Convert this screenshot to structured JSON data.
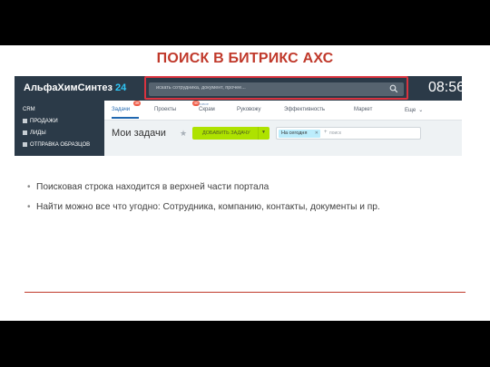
{
  "slide": {
    "title": "ПОИСК В БИТРИКС АХС",
    "bullets": [
      "Поисковая строка находится в верхней части портала",
      "Найти можно все что угодно: Сотрудника, компанию, контакты, документы и пр."
    ]
  },
  "portal": {
    "logo": "АльфаХимСинтез",
    "logo_number": "24",
    "search": {
      "placeholder": "искать сотрудника, документ, прочее..."
    },
    "clock": "08:56",
    "sidebar": {
      "items": [
        {
          "label": "CRM",
          "icon": "none"
        },
        {
          "label": "ПРОДАЖИ",
          "icon": "square-icon"
        },
        {
          "label": "ЛИДЫ",
          "icon": "square-icon"
        },
        {
          "label": "ОТПРАВКА ОБРАЗЦОВ",
          "icon": "square-icon"
        }
      ]
    },
    "tabs": [
      {
        "label": "Задачи",
        "badge": "38",
        "active": true
      },
      {
        "label": "Проекты",
        "badge": "40"
      },
      {
        "label": "Скрам",
        "note": "новое"
      },
      {
        "label": "Руковожу"
      },
      {
        "label": "Эффективность"
      },
      {
        "label": "Маркет"
      },
      {
        "label": "Еще",
        "icon": "chevron-down-icon"
      }
    ],
    "tasks": {
      "title": "Мои задачи",
      "add_button": "ДОБАВИТЬ ЗАДАЧУ",
      "filter_chip": "На сегодня",
      "filter_placeholder": "поиск"
    }
  },
  "colors": {
    "title": "#c0392b",
    "topbar": "#2b3a48",
    "highlight": "#d9333f",
    "add_button": "#aee200",
    "active_tab": "#2067b0",
    "logo_number": "#2fc6f6"
  }
}
